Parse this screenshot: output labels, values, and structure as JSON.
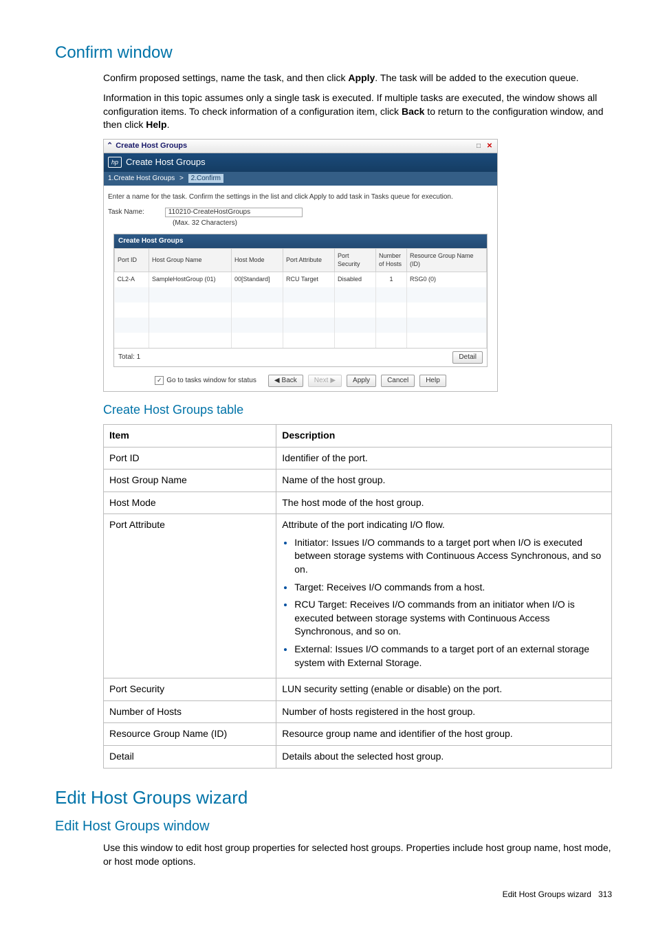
{
  "section1": {
    "title": "Confirm window",
    "p1_a": "Confirm proposed settings, name the task, and then click ",
    "p1_b": "Apply",
    "p1_c": ". The task will be added to the execution queue.",
    "p2_a": "Information in this topic assumes only a single task is executed. If multiple tasks are executed, the window shows all configuration items. To check information of a configuration item, click ",
    "p2_b": "Back",
    "p2_c": " to return to the configuration window, and then click ",
    "p2_d": "Help",
    "p2_e": "."
  },
  "shot": {
    "win_title": "Create Host Groups",
    "header": "Create Host Groups",
    "bc1": "1.Create Host Groups",
    "bc_sep": ">",
    "bc2": "2.Confirm",
    "instruction": "Enter a name for the task. Confirm the settings in the list and click Apply to add task in Tasks queue for execution.",
    "task_label": "Task Name:",
    "task_value": "110210-CreateHostGroups",
    "task_hint": "(Max. 32 Characters)",
    "panel_title": "Create Host Groups",
    "cols": {
      "c1": "Port ID",
      "c2": "Host Group Name",
      "c3": "Host Mode",
      "c4": "Port Attribute",
      "c5": "Port Security",
      "c6": "Number of Hosts",
      "c7": "Resource Group Name (ID)"
    },
    "row": {
      "c1": "CL2-A",
      "c2": "SampleHostGroup (01)",
      "c3": "00[Standard]",
      "c4": "RCU Target",
      "c5": "Disabled",
      "c6": "1",
      "c7": "RSG0 (0)"
    },
    "total_label": "Total: 1",
    "detail_btn": "Detail",
    "go_tasks": "Go to tasks window for status",
    "back_btn": "Back",
    "next_btn": "Next",
    "apply_btn": "Apply",
    "cancel_btn": "Cancel",
    "help_btn": "Help"
  },
  "table_section": {
    "title": "Create Host Groups table",
    "hdr_item": "Item",
    "hdr_desc": "Description",
    "rows": {
      "r1i": "Port ID",
      "r1d": "Identifier of the port.",
      "r2i": "Host Group Name",
      "r2d": "Name of the host group.",
      "r3i": "Host Mode",
      "r3d": "The host mode of the host group.",
      "r4i": "Port Attribute",
      "r4d_intro": "Attribute of the port indicating I/O flow.",
      "r4d_b1": "Initiator: Issues I/O commands to a target port when I/O is executed between storage systems with Continuous Access Synchronous, and so on.",
      "r4d_b2": "Target: Receives I/O commands from a host.",
      "r4d_b3": "RCU Target: Receives I/O commands from an initiator when I/O is executed between storage systems with Continuous Access Synchronous, and so on.",
      "r4d_b4": "External: Issues I/O commands to a target port of an external storage system with External Storage.",
      "r5i": "Port Security",
      "r5d": "LUN security setting (enable or disable) on the port.",
      "r6i": "Number of Hosts",
      "r6d": "Number of hosts registered in the host group.",
      "r7i": "Resource Group Name (ID)",
      "r7d": "Resource group name and identifier of the host group.",
      "r8i": "Detail",
      "r8d": "Details about the selected host group."
    }
  },
  "section2": {
    "title": "Edit Host Groups wizard",
    "sub": "Edit Host Groups window",
    "p": "Use this window to edit host group properties for selected host groups. Properties include host group name, host mode, or host mode options."
  },
  "footer": {
    "label": "Edit Host Groups wizard",
    "page": "313"
  }
}
